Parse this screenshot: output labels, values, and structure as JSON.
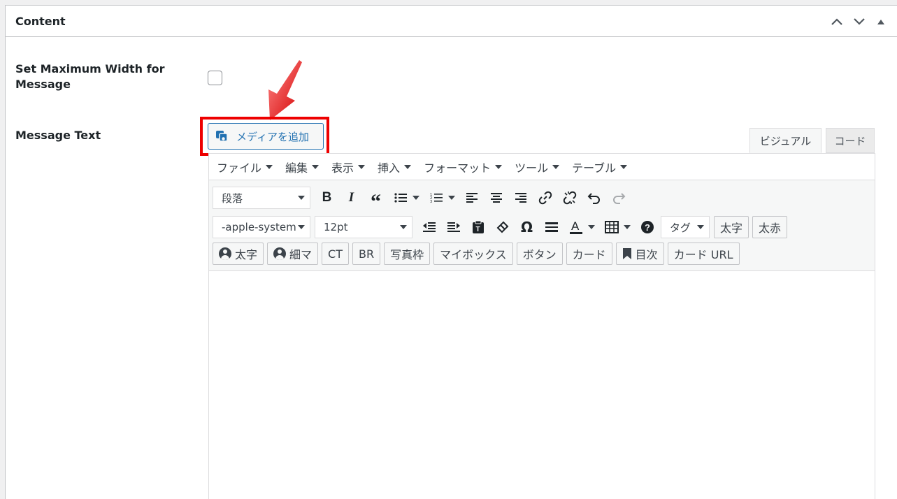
{
  "panel": {
    "title": "Content",
    "icons": [
      "chevron-up-icon",
      "chevron-down-icon",
      "triangle-up-icon"
    ]
  },
  "fields": {
    "max_width_label": "Set Maximum Width for Message",
    "max_width_checked": false,
    "message_text_label": "Message Text"
  },
  "media_button": {
    "label": "メディアを追加",
    "icon": "media-icon"
  },
  "highlight_color": "#ee0000",
  "tabs": {
    "visual": "ビジュアル",
    "code": "コード"
  },
  "menubar": [
    "ファイル",
    "編集",
    "表示",
    "挿入",
    "フォーマット",
    "ツール",
    "テーブル"
  ],
  "toolbar": {
    "paragraph_select": "段落",
    "font_family_select": "-apple-system",
    "font_size_select": "12pt",
    "tag_select": "タグ",
    "row1_icons": [
      "bold-icon",
      "italic-icon",
      "blockquote-icon",
      "bullet-list-icon",
      "numbered-list-icon",
      "align-left-icon",
      "align-center-icon",
      "align-right-icon",
      "link-icon",
      "unlink-icon",
      "undo-icon",
      "redo-icon"
    ],
    "row2_icons": [
      "outdent-icon",
      "indent-icon",
      "paste-text-icon",
      "clear-formatting-icon",
      "special-character-icon",
      "horizontal-line-icon",
      "text-color-icon",
      "table-icon",
      "help-icon"
    ],
    "buttons_row2": [
      "太字",
      "太赤"
    ],
    "buttons_row3": [
      {
        "label": "太字",
        "icon": "user-circle-icon"
      },
      {
        "label": "細マ",
        "icon": "user-circle-icon"
      },
      {
        "label": "CT"
      },
      {
        "label": "BR"
      },
      {
        "label": "写真枠"
      },
      {
        "label": "マイボックス"
      },
      {
        "label": "ボタン"
      },
      {
        "label": "カード"
      },
      {
        "label": "目次",
        "icon": "bookmark-icon"
      },
      {
        "label": "カード URL"
      }
    ]
  }
}
